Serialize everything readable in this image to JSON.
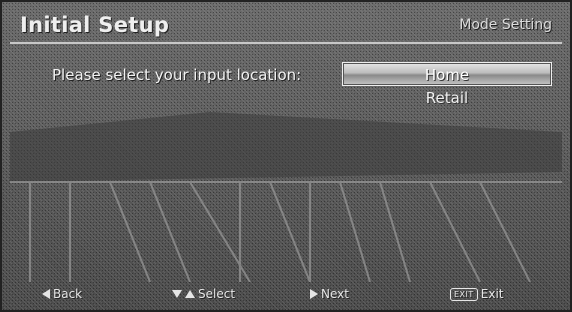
{
  "header": {
    "title": "Initial Setup",
    "section": "Mode Setting"
  },
  "prompt": "Please select your input location:",
  "options": [
    {
      "label": "Home",
      "selected": true
    },
    {
      "label": "Retail",
      "selected": false
    }
  ],
  "footer": {
    "back_label": "Back",
    "select_label": "Select",
    "next_label": "Next",
    "exit_key_label": "EXIT",
    "exit_label": "Exit"
  }
}
